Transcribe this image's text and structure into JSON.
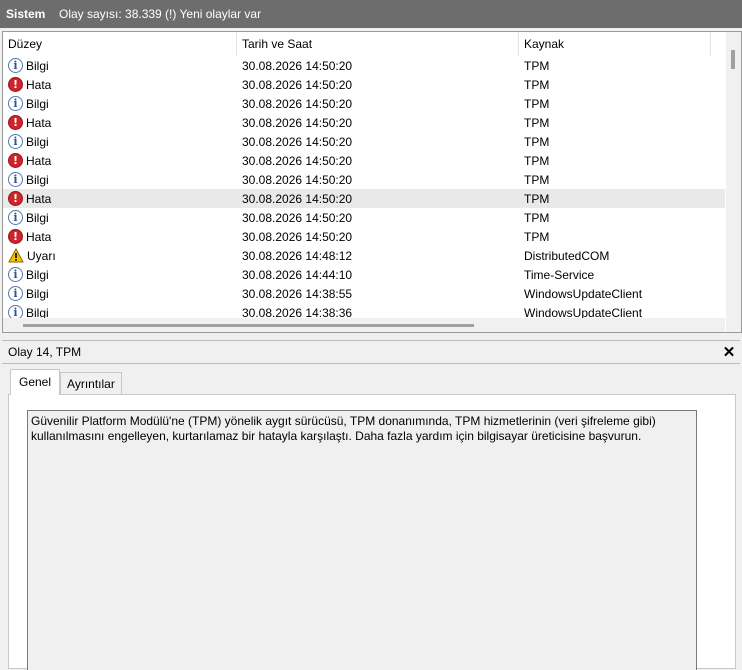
{
  "header": {
    "title": "Sistem",
    "summary": "Olay sayısı: 38.339 (!) Yeni olaylar var"
  },
  "columns": {
    "level": "Düzey",
    "date": "Tarih ve Saat",
    "source": "Kaynak"
  },
  "rows": [
    {
      "type": "info",
      "level": "Bilgi",
      "date": "30.08.2026 14:50:20",
      "source": "TPM"
    },
    {
      "type": "error",
      "level": "Hata",
      "date": "30.08.2026 14:50:20",
      "source": "TPM"
    },
    {
      "type": "info",
      "level": "Bilgi",
      "date": "30.08.2026 14:50:20",
      "source": "TPM"
    },
    {
      "type": "error",
      "level": "Hata",
      "date": "30.08.2026 14:50:20",
      "source": "TPM"
    },
    {
      "type": "info",
      "level": "Bilgi",
      "date": "30.08.2026 14:50:20",
      "source": "TPM"
    },
    {
      "type": "error",
      "level": "Hata",
      "date": "30.08.2026 14:50:20",
      "source": "TPM"
    },
    {
      "type": "info",
      "level": "Bilgi",
      "date": "30.08.2026 14:50:20",
      "source": "TPM"
    },
    {
      "type": "error",
      "level": "Hata",
      "date": "30.08.2026 14:50:20",
      "source": "TPM",
      "selected": true
    },
    {
      "type": "info",
      "level": "Bilgi",
      "date": "30.08.2026 14:50:20",
      "source": "TPM"
    },
    {
      "type": "error",
      "level": "Hata",
      "date": "30.08.2026 14:50:20",
      "source": "TPM"
    },
    {
      "type": "warning",
      "level": "Uyarı",
      "date": "30.08.2026 14:48:12",
      "source": "DistributedCOM"
    },
    {
      "type": "info",
      "level": "Bilgi",
      "date": "30.08.2026 14:44:10",
      "source": "Time-Service"
    },
    {
      "type": "info",
      "level": "Bilgi",
      "date": "30.08.2026 14:38:55",
      "source": "WindowsUpdateClient"
    },
    {
      "type": "info",
      "level": "Bilgi",
      "date": "30.08.2026 14:38:36",
      "source": "WindowsUpdateClient"
    }
  ],
  "icons": {
    "info": "info-icon",
    "error": "error-icon",
    "warning": "warning-icon"
  },
  "detail": {
    "title": "Olay 14, TPM",
    "close": "✕",
    "tabs": [
      "Genel",
      "Ayrıntılar"
    ],
    "description": "Güvenilir Platform Modülü'ne (TPM) yönelik aygıt sürücüsü, TPM donanımında, TPM hizmetlerinin (veri şifreleme gibi) kullanılmasını engelleyen, kurtarılamaz bir hatayla karşılaştı. Daha fazla yardım için bilgisayar üreticisine başvurun."
  },
  "colors": {
    "header_bg": "#6d6d6d",
    "error": "#d0242c",
    "info": "#2c5599",
    "warning": "#f5c400",
    "selected_row": "#e9e9e9"
  }
}
